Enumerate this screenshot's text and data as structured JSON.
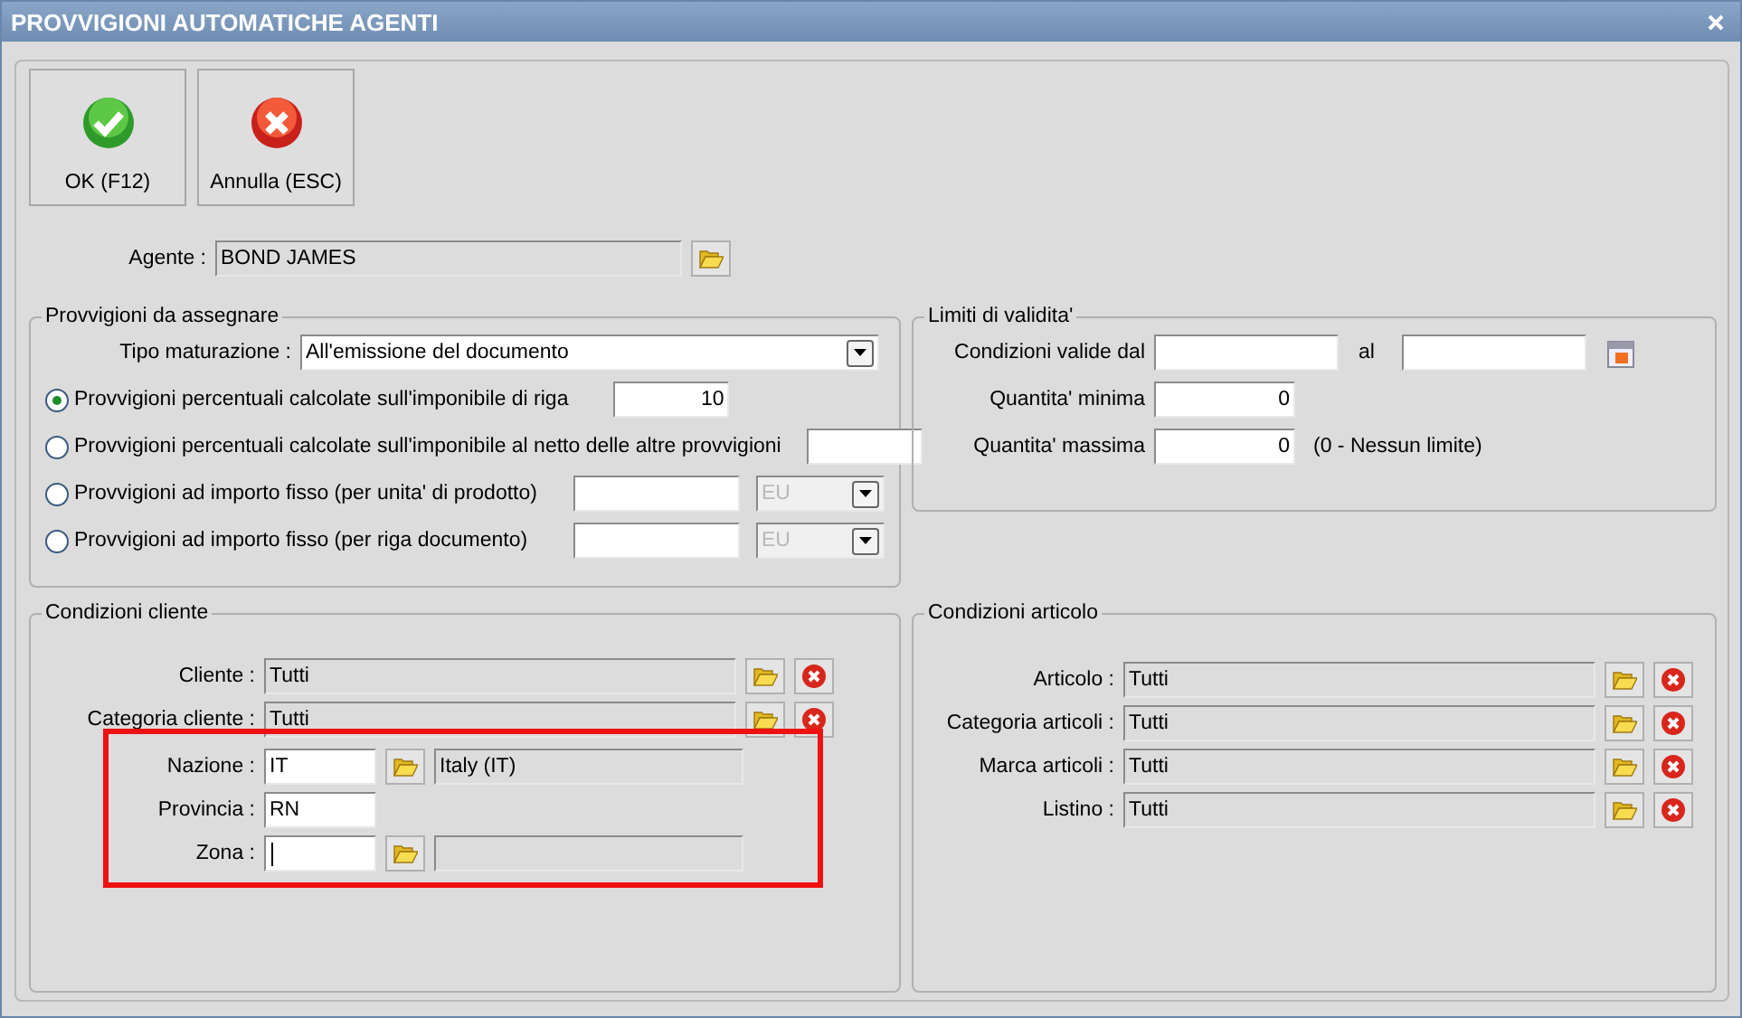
{
  "window": {
    "title": "PROVVIGIONI AUTOMATICHE AGENTI"
  },
  "toolbar": [
    {
      "kind": "ok",
      "label": "OK (F12)"
    },
    {
      "kind": "cancel",
      "label": "Annulla (ESC)"
    }
  ],
  "agent": {
    "label": "Agente :",
    "value": "BOND JAMES"
  },
  "commissions": {
    "legend": "Provvigioni da assegnare",
    "accrual": {
      "label": "Tipo maturazione :",
      "value": "All'emissione del documento"
    },
    "options": [
      {
        "kind": "percent",
        "label": "Provvigioni percentuali calcolate sull'imponibile di riga",
        "selected": true,
        "value": "10"
      },
      {
        "kind": "percent_net",
        "label": "Provvigioni percentuali calcolate sull'imponibile al netto delle altre provvigioni",
        "selected": false
      },
      {
        "kind": "fixed",
        "label": "Provvigioni ad importo fisso (per unita' di prodotto)",
        "selected": false,
        "unit": "EU"
      },
      {
        "kind": "fixed",
        "label": "Provvigioni ad importo fisso (per riga documento)",
        "selected": false,
        "unit": "EU"
      }
    ]
  },
  "validity": {
    "legend": "Limiti di validita'",
    "from_label": "Condizioni valide dal",
    "to_label": "al",
    "min_label": "Quantita' minima",
    "min_value": "0",
    "max_label": "Quantita' massima",
    "max_value": "0",
    "max_note": "(0 - Nessun limite)"
  },
  "customer": {
    "legend": "Condizioni cliente",
    "rows": [
      {
        "label": "Cliente :",
        "value": "Tutti"
      },
      {
        "label": "Categoria cliente :",
        "value": "Tutti"
      }
    ],
    "nation": {
      "label": "Nazione :",
      "value": "IT",
      "description": "Italy (IT)"
    },
    "province": {
      "label": "Provincia :",
      "value": "RN"
    },
    "zone": {
      "label": "Zona :",
      "focused": true
    }
  },
  "article": {
    "legend": "Condizioni articolo",
    "rows": [
      {
        "label": "Articolo :",
        "value": "Tutti"
      },
      {
        "label": "Categoria articoli :",
        "value": "Tutti"
      },
      {
        "label": "Marca articoli :",
        "value": "Tutti"
      },
      {
        "label": "Listino :",
        "value": "Tutti"
      }
    ]
  }
}
